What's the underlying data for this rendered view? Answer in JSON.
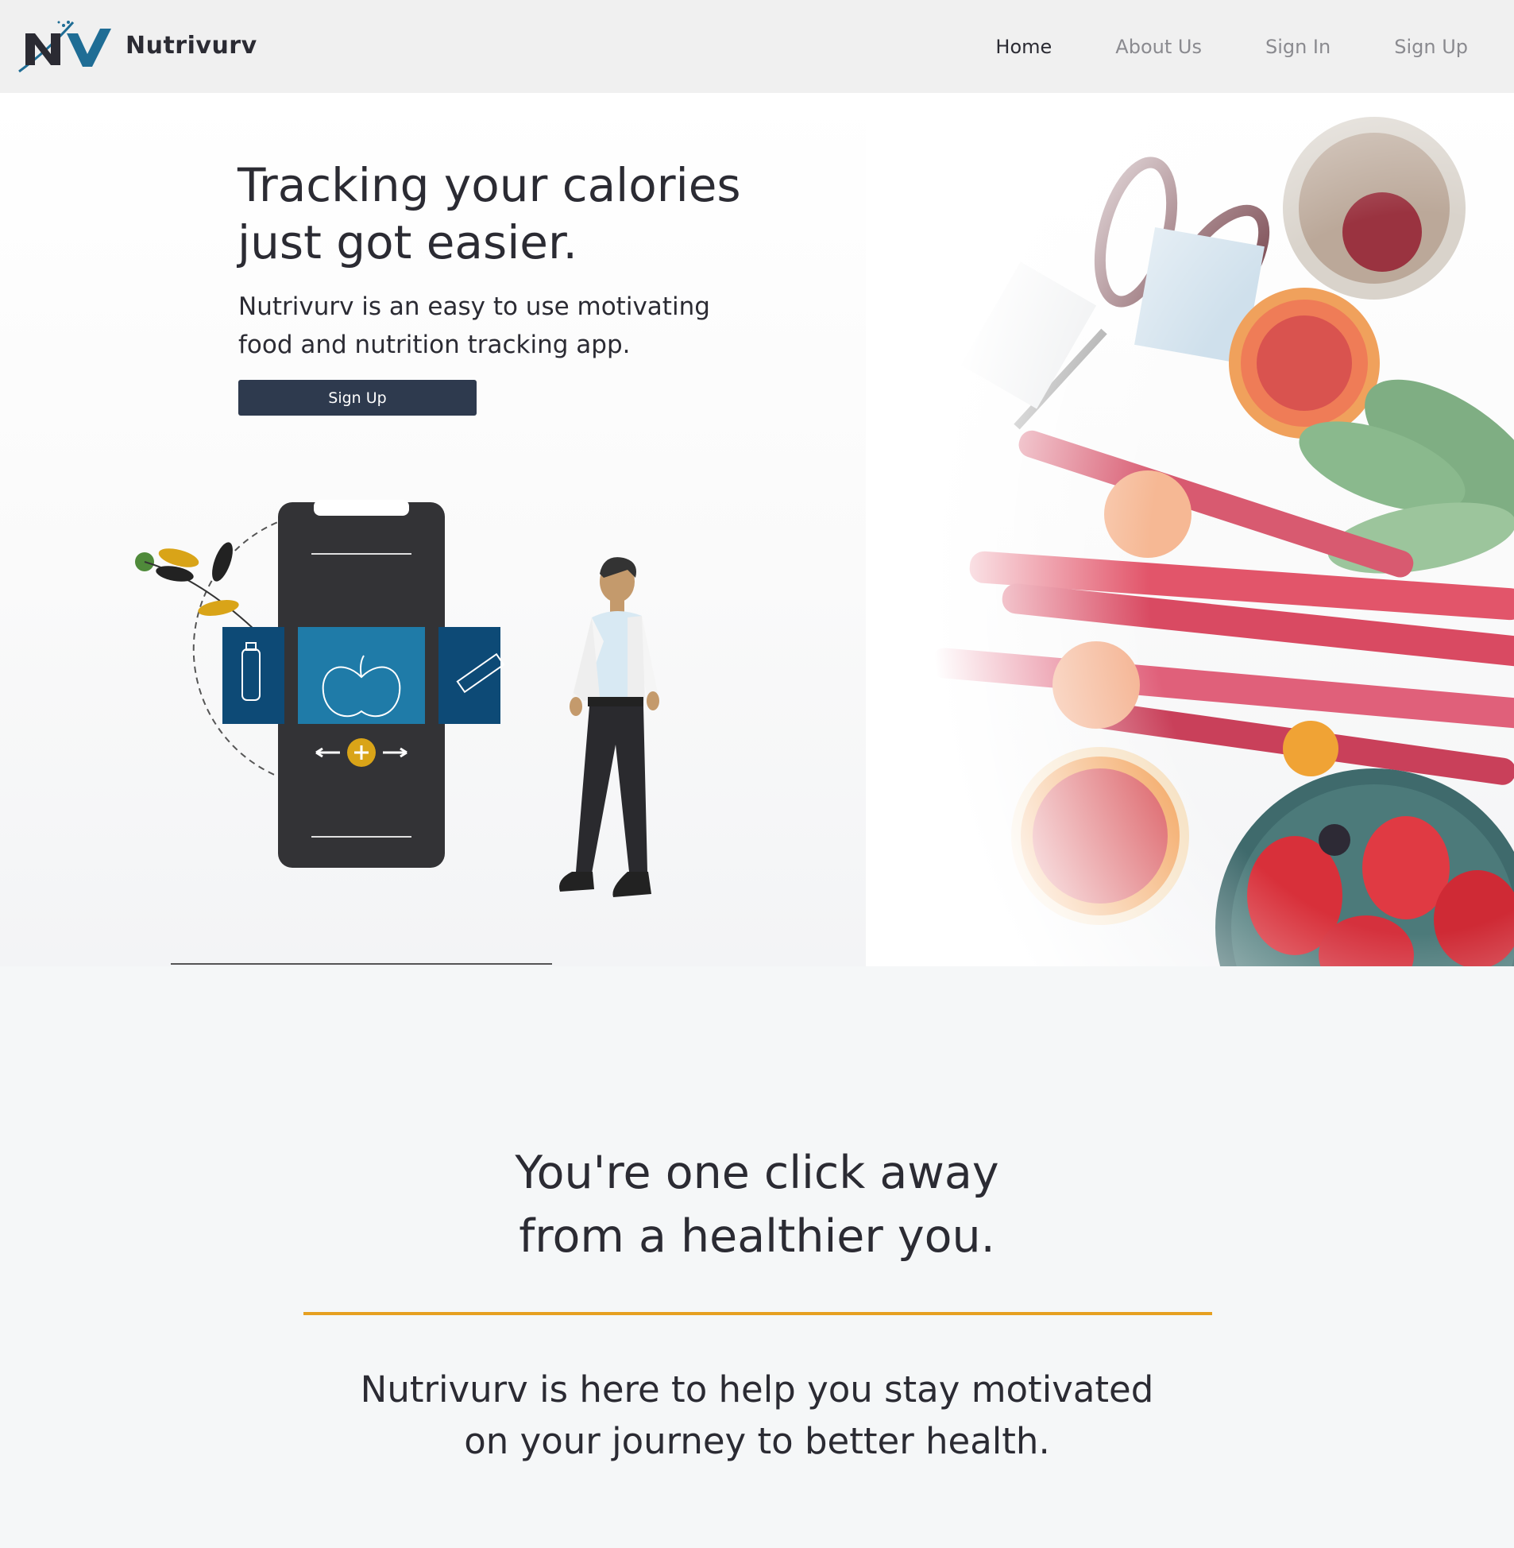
{
  "brand": {
    "name": "Nutrivurv",
    "logo_icon": "nv-logo-icon",
    "colors": {
      "dark": "#2b2b33",
      "accent": "#1f6d95"
    }
  },
  "nav": {
    "items": [
      {
        "label": "Home",
        "active": true
      },
      {
        "label": "About Us",
        "active": false
      },
      {
        "label": "Sign In",
        "active": false
      },
      {
        "label": "Sign Up",
        "active": false
      }
    ]
  },
  "hero": {
    "title_line1": "Tracking your calories",
    "title_line2": "just got easier.",
    "subtitle_line1": "Nutrivurv is an easy to use motivating",
    "subtitle_line2": "food and nutrition tracking app.",
    "cta_label": "Sign Up",
    "cta_color": "#2e3a4e",
    "illustration": "phone-food-tracking-illustration",
    "photo": "fruit-vegetables-photo"
  },
  "section2": {
    "title_line1": "You're one click away",
    "title_line2": "from a healthier you.",
    "divider_color": "#e6a021",
    "text_line1": "Nutrivurv is here to help you stay motivated",
    "text_line2": "on your journey to better health."
  }
}
